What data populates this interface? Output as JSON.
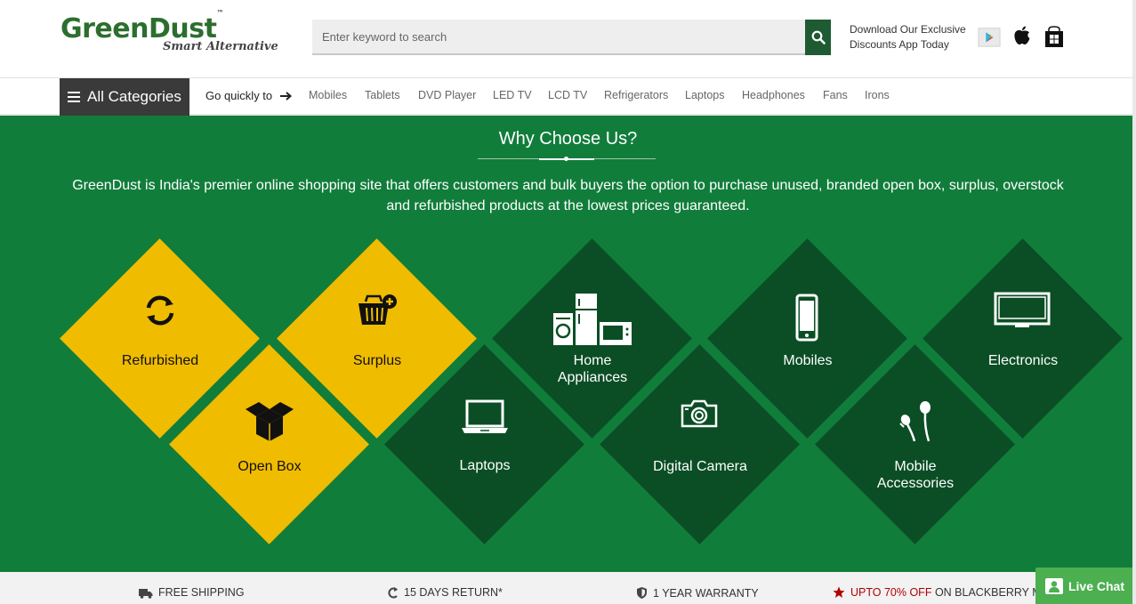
{
  "header": {
    "logo_text": "GreenDust",
    "logo_tm": "™",
    "logo_tagline": "Smart Alternative",
    "search_placeholder": "Enter keyword to search",
    "app_line1": "Download Our Exclusive",
    "app_line2": "Discounts App Today",
    "store_icons": [
      "google-play-icon",
      "apple-icon",
      "windows-icon"
    ]
  },
  "nav": {
    "all_categories": "All Categories",
    "go_quickly": "Go quickly to",
    "links": [
      "Mobiles",
      "Tablets",
      "DVD Player",
      "LED TV",
      "LCD TV",
      "Refrigerators",
      "Laptops",
      "Headphones",
      "Fans",
      "Irons"
    ]
  },
  "why": {
    "title": "Why Choose Us?",
    "description": "GreenDust is India's premier online shopping site that offers customers and bulk buyers the option to purchase unused, branded open box, surplus, overstock and refurbished products at the lowest prices guaranteed.",
    "tiles": {
      "refurbished": {
        "label": "Refurbished",
        "icon": "refresh-icon"
      },
      "surplus": {
        "label": "Surplus",
        "icon": "basket-icon"
      },
      "open_box": {
        "label": "Open Box",
        "icon": "box-icon"
      },
      "laptops": {
        "label": "Laptops",
        "icon": "laptop-icon"
      },
      "home_appliances": {
        "label_1": "Home",
        "label_2": "Appliances",
        "icon": "appliances-icon"
      },
      "digital_camera": {
        "label": "Digital Camera",
        "icon": "camera-icon"
      },
      "mobiles": {
        "label": "Mobiles",
        "icon": "mobile-icon"
      },
      "mobile_accessories": {
        "label_1": "Mobile",
        "label_2": "Accessories",
        "icon": "earphones-icon"
      },
      "electronics": {
        "label": "Electronics",
        "icon": "monitor-icon"
      }
    }
  },
  "features": {
    "free_shipping": "FREE SHIPPING",
    "returns": "15 DAYS RETURN*",
    "warranty": "1 YEAR WARRANTY",
    "offer_highlight": "UPTO 70% OFF",
    "offer_rest": " ON BLACKBERRY MO"
  },
  "live_chat": "Live Chat",
  "colors": {
    "brand_green": "#117d3b",
    "dark_green": "#0b4e25",
    "yellow": "#f0bc00",
    "search_button": "#1e5a32",
    "live_chat": "#4caf50"
  }
}
